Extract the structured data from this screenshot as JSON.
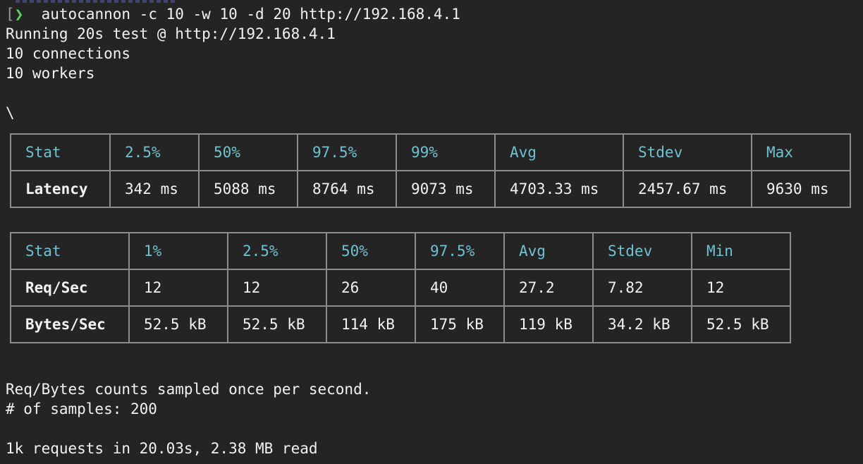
{
  "terminal": {
    "prompt": {
      "bracket": "[",
      "chevron": "❯",
      "command": "autocannon -c 10 -w 10 -d 20 http://192.168.4.1"
    },
    "output": {
      "running": "Running 20s test @ http://192.168.4.1",
      "connections": "10 connections",
      "workers": "10 workers",
      "spinner": "\\"
    },
    "latency_table": {
      "headers": [
        "Stat",
        "2.5%",
        "50%",
        "97.5%",
        "99%",
        "Avg",
        "Stdev",
        "Max"
      ],
      "rows": [
        [
          "Latency",
          "342 ms",
          "5088 ms",
          "8764 ms",
          "9073 ms",
          "4703.33 ms",
          "2457.67 ms",
          "9630 ms"
        ]
      ]
    },
    "throughput_table": {
      "headers": [
        "Stat",
        "1%",
        "2.5%",
        "50%",
        "97.5%",
        "Avg",
        "Stdev",
        "Min"
      ],
      "rows": [
        [
          "Req/Sec",
          "12",
          "12",
          "26",
          "40",
          "27.2",
          "7.82",
          "12"
        ],
        [
          "Bytes/Sec",
          "52.5 kB",
          "52.5 kB",
          "114 kB",
          "175 kB",
          "119 kB",
          "34.2 kB",
          "52.5 kB"
        ]
      ]
    },
    "footer": {
      "sampling_note": "Req/Bytes counts sampled once per second.",
      "samples": "# of samples: 200",
      "summary": "1k requests in 20.03s, 2.38 MB read"
    },
    "colors": {
      "background": "#242424",
      "text": "#f2f2f2",
      "header_cyan": "#6fc2d0",
      "prompt_green": "#5fd35f",
      "border": "#8c8c8c"
    }
  }
}
